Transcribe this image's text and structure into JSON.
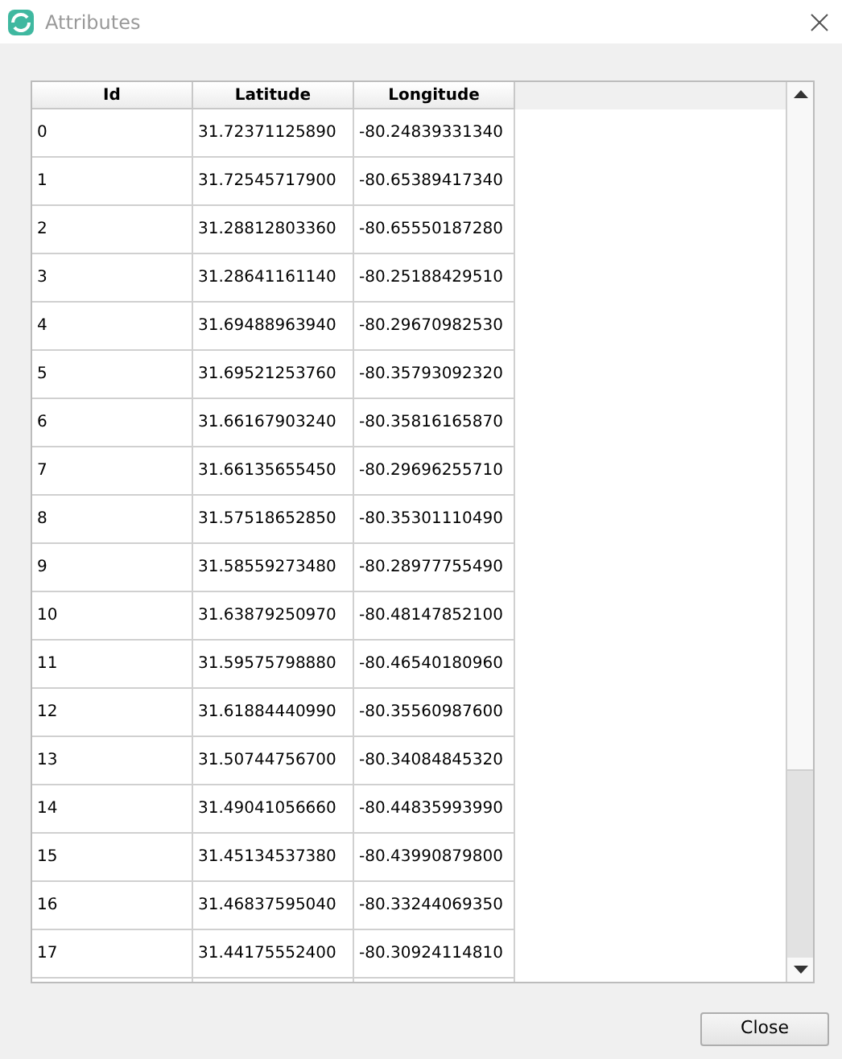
{
  "window": {
    "title": "Attributes"
  },
  "table": {
    "columns": [
      "Id",
      "Latitude",
      "Longitude"
    ],
    "rows": [
      [
        "0",
        "31.72371125890",
        "-80.24839331340"
      ],
      [
        "1",
        "31.72545717900",
        "-80.65389417340"
      ],
      [
        "2",
        "31.28812803360",
        "-80.65550187280"
      ],
      [
        "3",
        "31.28641161140",
        "-80.25188429510"
      ],
      [
        "4",
        "31.69488963940",
        "-80.29670982530"
      ],
      [
        "5",
        "31.69521253760",
        "-80.35793092320"
      ],
      [
        "6",
        "31.66167903240",
        "-80.35816165870"
      ],
      [
        "7",
        "31.66135655450",
        "-80.29696255710"
      ],
      [
        "8",
        "31.57518652850",
        "-80.35301110490"
      ],
      [
        "9",
        "31.58559273480",
        "-80.28977755490"
      ],
      [
        "10",
        "31.63879250970",
        "-80.48147852100"
      ],
      [
        "11",
        "31.59575798880",
        "-80.46540180960"
      ],
      [
        "12",
        "31.61884440990",
        "-80.35560987600"
      ],
      [
        "13",
        "31.50744756700",
        "-80.34084845320"
      ],
      [
        "14",
        "31.49041056660",
        "-80.44835993990"
      ],
      [
        "15",
        "31.45134537380",
        "-80.43990879800"
      ],
      [
        "16",
        "31.46837595040",
        "-80.33244069350"
      ],
      [
        "17",
        "31.44175552400",
        "-80.30924114810"
      ]
    ]
  },
  "buttons": [
    "Close"
  ]
}
